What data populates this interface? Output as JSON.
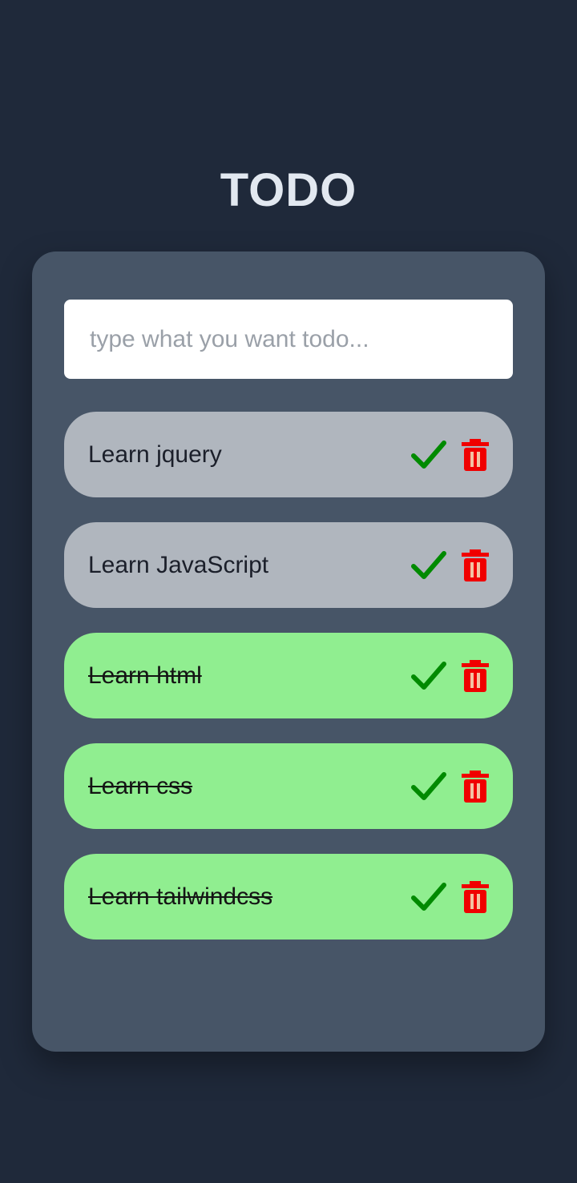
{
  "app": {
    "title": "TODO"
  },
  "input": {
    "placeholder": "type what you want todo...",
    "value": ""
  },
  "colors": {
    "background": "#1f293a",
    "card": "#475567",
    "pending_item": "#b0b6be",
    "done_item": "#90ee90",
    "check_icon": "#008a00",
    "trash_icon": "#f00000"
  },
  "todos": [
    {
      "label": "Learn jquery",
      "done": false
    },
    {
      "label": "Learn JavaScript",
      "done": false
    },
    {
      "label": "Learn html",
      "done": true
    },
    {
      "label": "Learn css",
      "done": true
    },
    {
      "label": "Learn tailwindcss",
      "done": true
    }
  ]
}
